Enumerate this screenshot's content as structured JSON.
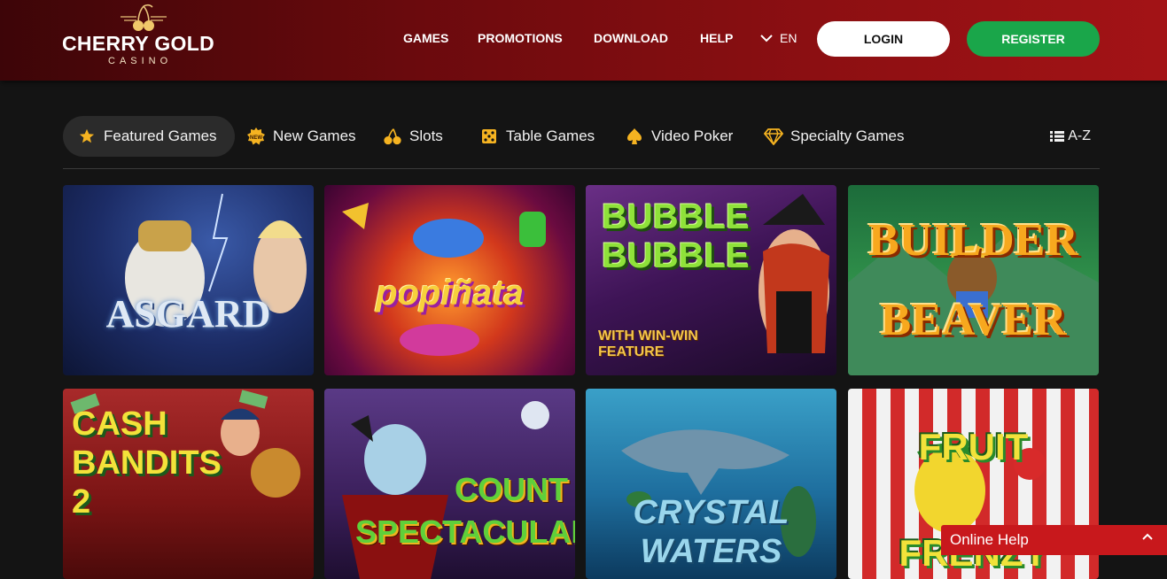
{
  "header": {
    "logo": {
      "brand": "CHERRY GOLD",
      "sub": "CASINO"
    },
    "nav": [
      "GAMES",
      "PROMOTIONS",
      "DOWNLOAD",
      "HELP"
    ],
    "language": "EN",
    "login_label": "LOGIN",
    "register_label": "REGISTER"
  },
  "categories": {
    "items": [
      {
        "label": "Featured Games",
        "icon": "star-icon",
        "active": true
      },
      {
        "label": "New Games",
        "icon": "new-badge-icon"
      },
      {
        "label": "Slots",
        "icon": "cherries-icon"
      },
      {
        "label": "Table Games",
        "icon": "dice-icon"
      },
      {
        "label": "Video Poker",
        "icon": "spade-icon"
      },
      {
        "label": "Specialty Games",
        "icon": "diamond-icon"
      }
    ],
    "az_label": "A-Z"
  },
  "games": [
    {
      "title": "ASGARD"
    },
    {
      "title": "popiñata"
    },
    {
      "title": "BUBBLE BUBBLE",
      "subtitle": "WITH WIN-WIN FEATURE"
    },
    {
      "title": "BUILDER BEAVER"
    },
    {
      "title": "CASH BANDITS 2"
    },
    {
      "title": "COUNT SPECTACULAR"
    },
    {
      "title": "CRYSTAL WATERS"
    },
    {
      "title": "FRUIT FRENZY"
    }
  ],
  "help": {
    "label": "Online Help"
  },
  "colors": {
    "accent_red": "#c8181c",
    "register_green": "#1aa64a",
    "gold": "#f5b321"
  }
}
